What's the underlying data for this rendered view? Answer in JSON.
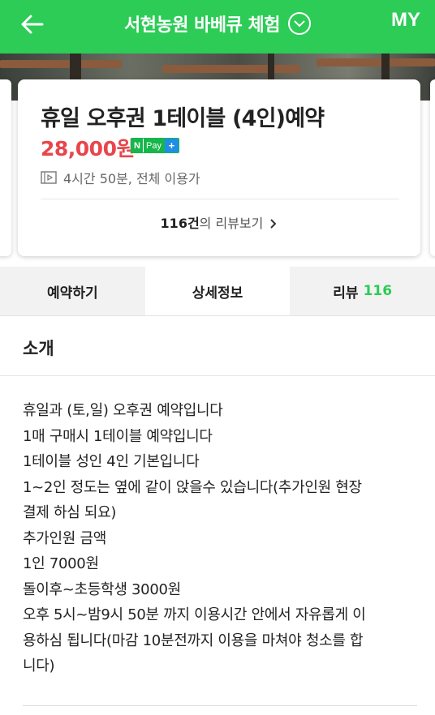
{
  "header": {
    "title": "서현농원 바베큐 체험",
    "my_label": "MY",
    "background": "#2ccc57",
    "back_icon": "arrow-left-icon",
    "dropdown_icon": "chevron-down-circle-icon"
  },
  "product": {
    "title": "휴일 오후권 1테이블 (4인)예약",
    "price": "28,000원",
    "price_color": "#e8464b",
    "npay": {
      "n": "N",
      "pay": "Pay",
      "plus": "+"
    },
    "duration": "4시간 50분, 전체 이용가",
    "duration_icon": "play-square-icon",
    "review_count": "116건",
    "review_suffix": "의 리뷰보기",
    "review_arrow": "›"
  },
  "tabs": [
    {
      "label": "예약하기"
    },
    {
      "label": "상세정보"
    },
    {
      "label": "리뷰",
      "count": "116"
    }
  ],
  "section": {
    "title": "소개",
    "lines": [
      "휴일과 (토,일) 오후권 예약입니다",
      "1매 구매시 1테이블 예약입니다",
      "1테이블 성인 4인 기본입니다",
      "1~2인 정도는 옆에 같이 앉을수 있습니다(추가인원 현장",
      "결제 하심 되요)",
      "추가인원 금액",
      "1인 7000원",
      "돌이후~초등학생 3000원",
      "오후 5시~밤9시 50분 까지 이용시간 안에서 자유롭게 이",
      "용하심 됩니다(마감 10분전까지 이용을 마쳐야 청소를 합",
      "니다)"
    ]
  }
}
